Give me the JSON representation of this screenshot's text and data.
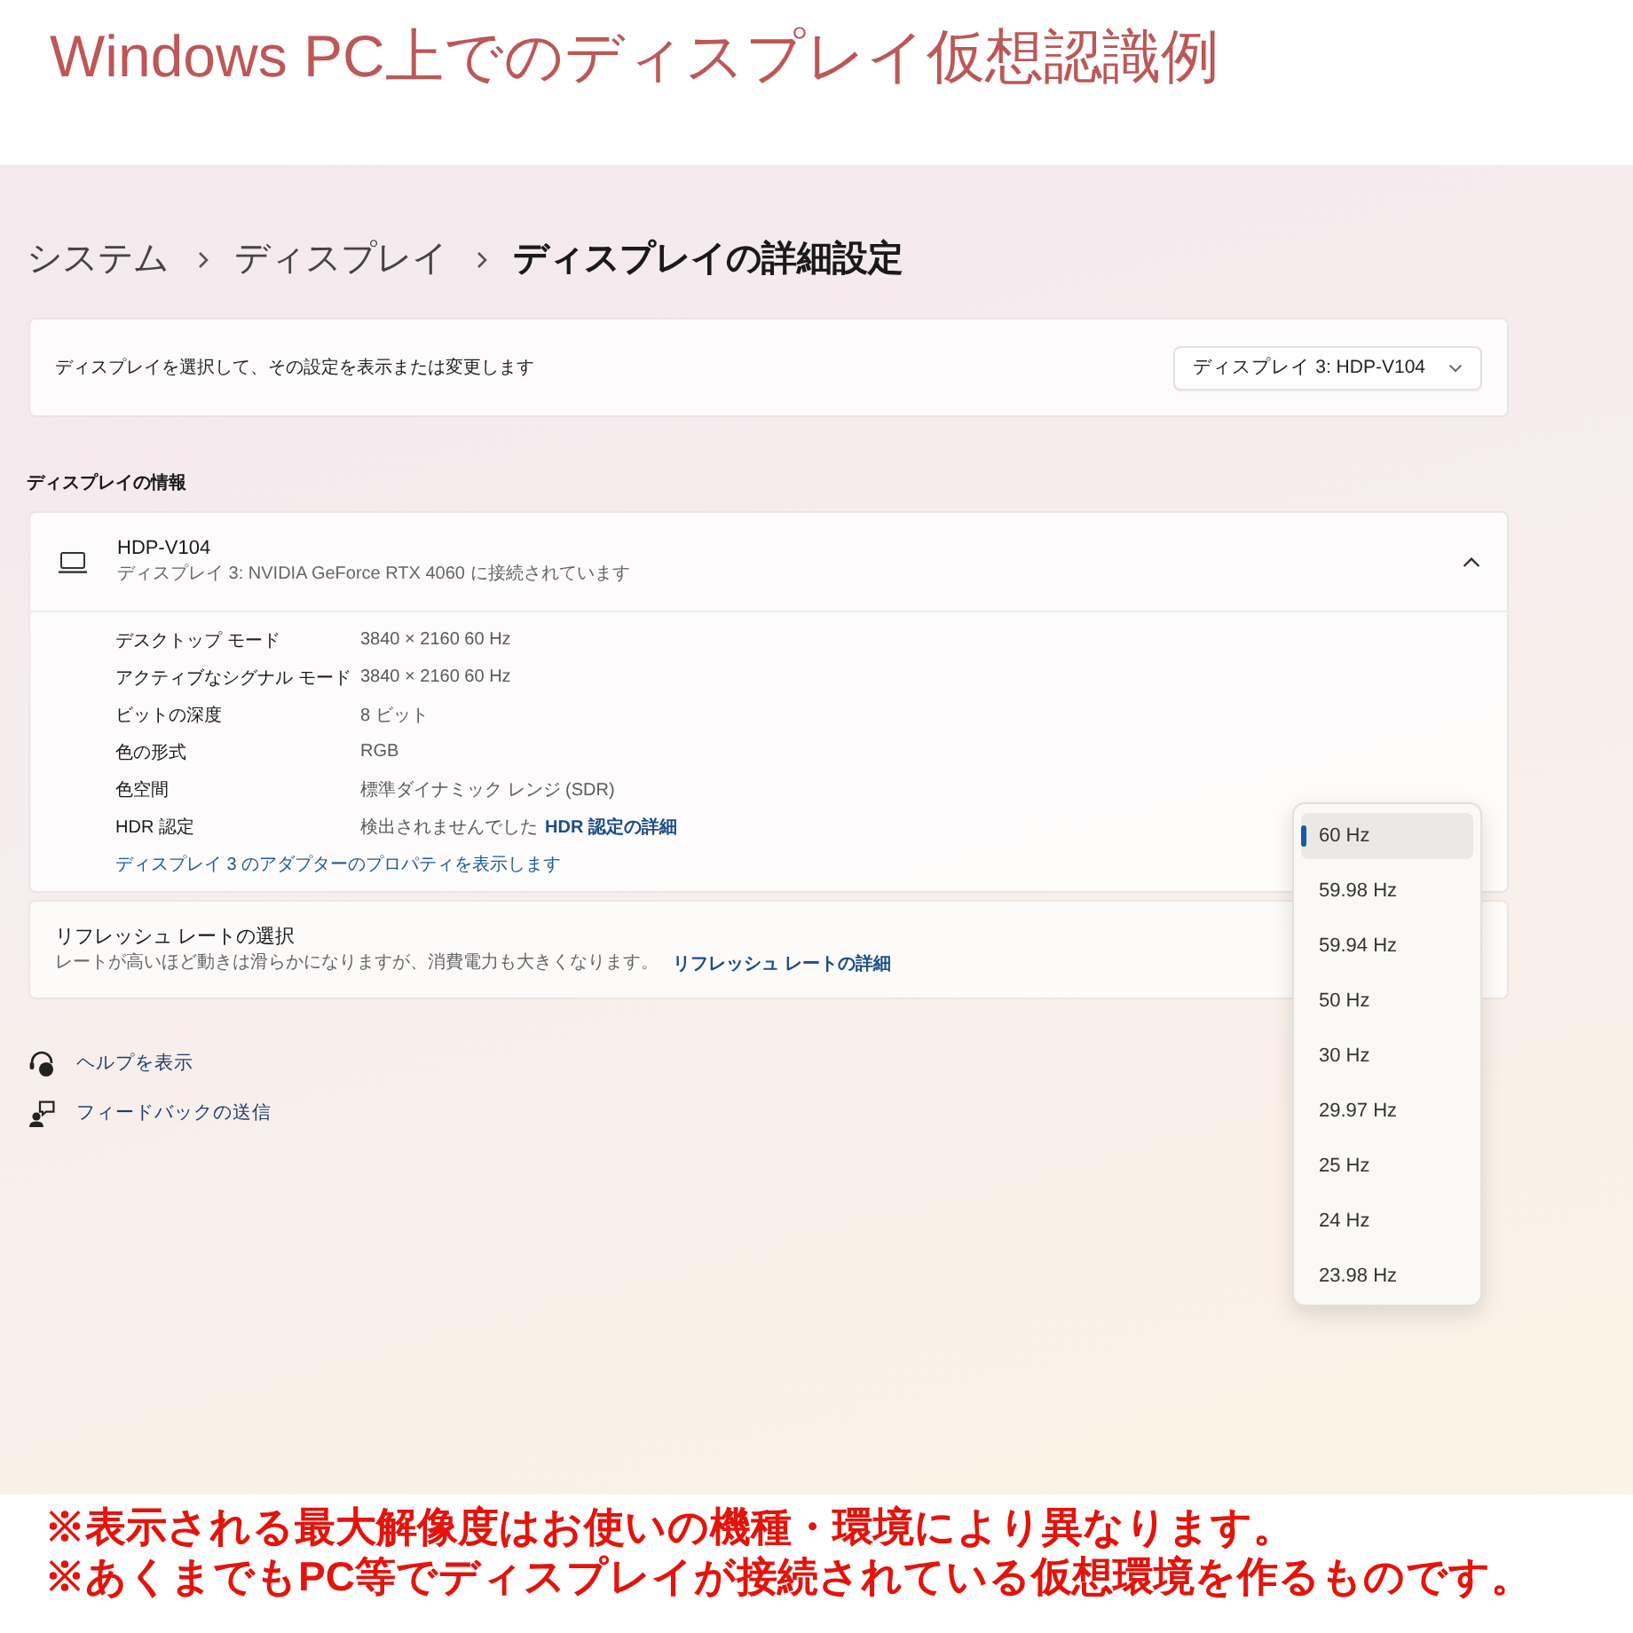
{
  "heading": "Windows PC上でのディスプレイ仮想認識例",
  "breadcrumb": [
    {
      "label": "システム",
      "current": false
    },
    {
      "label": "ディスプレイ",
      "current": false
    },
    {
      "label": "ディスプレイの詳細設定",
      "current": true
    }
  ],
  "display_select": {
    "label": "ディスプレイを選択して、その設定を表示または変更します",
    "value": "ディスプレイ 3: HDP-V104"
  },
  "display_info": {
    "title": "ディスプレイの情報",
    "name": "HDP-V104",
    "subtitle": "ディスプレイ 3: NVIDIA GeForce RTX 4060 に接続されています",
    "expanded": true,
    "rows": [
      {
        "label": "デスクトップ モード",
        "value": "3840 × 2160 60 Hz"
      },
      {
        "label": "アクティブなシグナル モード",
        "value": "3840 × 2160 60 Hz"
      },
      {
        "label": "ビットの深度",
        "value": "8 ビット"
      },
      {
        "label": "色の形式",
        "value": "RGB"
      },
      {
        "label": "色空間",
        "value": "標準ダイナミック レンジ (SDR)"
      },
      {
        "label": "HDR 認定",
        "value": "検出されませんでした",
        "link": "HDR 認定の詳細"
      }
    ],
    "adapter_link": "ディスプレイ 3 のアダプターのプロパティを表示します"
  },
  "refresh_rate": {
    "title": "リフレッシュ レートの選択",
    "description": "レートが高いほど動きは滑らかになりますが、消費電力も大きくなります。",
    "link": "リフレッシュ レートの詳細",
    "options": [
      {
        "label": "60 Hz",
        "selected": true
      },
      {
        "label": "59.98 Hz",
        "selected": false
      },
      {
        "label": "59.94 Hz",
        "selected": false
      },
      {
        "label": "50 Hz",
        "selected": false
      },
      {
        "label": "30 Hz",
        "selected": false
      },
      {
        "label": "29.97 Hz",
        "selected": false
      },
      {
        "label": "25 Hz",
        "selected": false
      },
      {
        "label": "24 Hz",
        "selected": false
      },
      {
        "label": "23.98 Hz",
        "selected": false
      }
    ]
  },
  "help_links": [
    {
      "kind": "help",
      "label": "ヘルプを表示"
    },
    {
      "kind": "feedback",
      "label": "フィードバックの送信"
    }
  ],
  "notes": [
    "※表示される最大解像度はお使いの機種・環境により異なります。",
    "※あくまでもPC等でディスプレイが接続されている仮想環境を作るものです。"
  ]
}
